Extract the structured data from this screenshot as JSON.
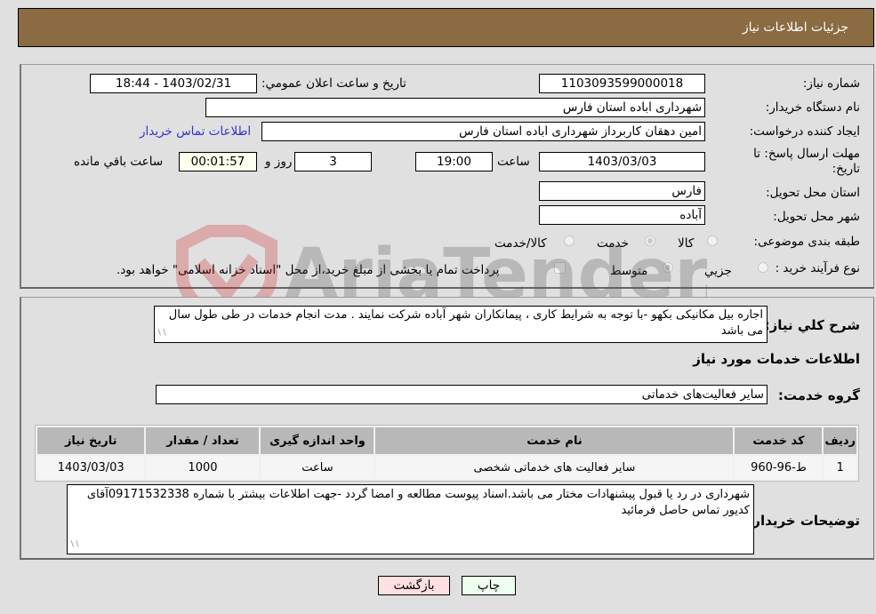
{
  "header": {
    "title": "جزئیات اطلاعات نیاز"
  },
  "need_info": {
    "need_number_label": "شماره نیاز:",
    "need_number": "1103093599000018",
    "announce_label": "تاریخ و ساعت اعلان عمومي:",
    "announce_value": "1403/02/31 - 18:44",
    "buyer_org_label": "نام دستگاه خریدار:",
    "buyer_org": "شهرداری اباده استان فارس",
    "requester_label": "ایجاد کننده درخواست:",
    "requester": "امین دهقان کاربرداز شهرداری اباده استان فارس",
    "contact_link": "اطلاعات تماس خریدار",
    "deadline_label_1": "مهلت ارسال پاسخ: تا",
    "deadline_label_2": "تاریخ:",
    "deadline_date": "1403/03/03",
    "time_label": "ساعت",
    "deadline_time": "19:00",
    "days_value": "3",
    "days_label": "روز و",
    "remaining_value": "00:01:57",
    "remaining_label": "ساعت باقي مانده",
    "province_label": "استان محل تحویل:",
    "province": "فارس",
    "city_label": "شهر محل تحویل:",
    "city": "آباده",
    "category_label": "طبقه بندی موضوعی:",
    "category_options": [
      {
        "label": "کالا",
        "selected": false
      },
      {
        "label": "خدمت",
        "selected": true
      },
      {
        "label": "کالا/خدمت",
        "selected": false
      }
    ],
    "process_label": "نوع فرآیند خرید :",
    "process_options": [
      {
        "label": "جزيي",
        "selected": false
      },
      {
        "label": "متوسط",
        "selected": true
      }
    ],
    "payment_note": "پرداخت تمام یا بخشی از مبلغ خرید،از محل \"اسناد خزانه اسلامی\" خواهد بود.",
    "payment_checked": false
  },
  "description": {
    "label": "شرح کلي نیاز:",
    "text": "اجاره بیل مکانیکی بکهو -با توجه به شرایط کاری ، پیمانکاران شهر آباده شرکت نمایند . مدت انجام خدمات در طی طول سال می باشد"
  },
  "services": {
    "section_title": "اطلاعات خدمات مورد نیاز",
    "group_label": "گروه خدمت:",
    "group_value": "سایر فعالیت‌های خدماتی",
    "columns": [
      "ردیف",
      "کد خدمت",
      "نام خدمت",
      "واحد اندازه گیری",
      "تعداد / مقدار",
      "تاریخ نیاز"
    ],
    "rows": [
      [
        "1",
        "ط-96-960",
        "سایر فعالیت های خدماتی شخصی",
        "ساعت",
        "1000",
        "1403/03/03"
      ]
    ]
  },
  "buyer_notes": {
    "label": "توضیحات خریدار:",
    "text": "شهرداری در رد یا قبول پیشنهادات مختار می باشد.اسناد پیوست مطالعه و امضا گردد -جهت اطلاعات بیشتر با شماره 09171532338آقای کدیور تماس حاصل فرمائید"
  },
  "buttons": {
    "print": "چاپ",
    "back": "بازگشت"
  },
  "watermark": {
    "text": "AriaTender.net"
  },
  "colors": {
    "header_bg": "#8b6b42",
    "back_bg": "#ffe0e0",
    "print_bg": "#eeffee",
    "link": "#3333cc"
  }
}
